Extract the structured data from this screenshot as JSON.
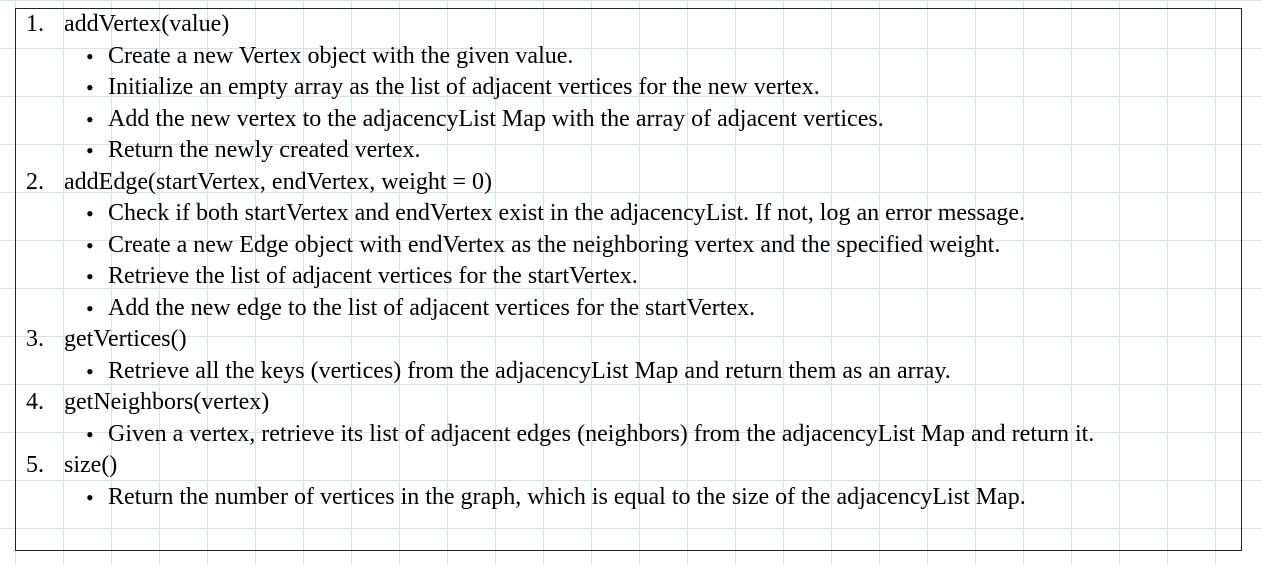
{
  "methods": [
    {
      "number": "1.",
      "signature": "addVertex(value)",
      "steps": [
        "Create a new Vertex object with the given value.",
        "Initialize an empty array as the list of adjacent vertices for the new vertex.",
        "Add the new vertex to the adjacencyList Map with the array of adjacent vertices.",
        "Return the newly created vertex."
      ]
    },
    {
      "number": "2.",
      "signature": "addEdge(startVertex, endVertex, weight = 0)",
      "steps": [
        "Check if both startVertex and endVertex exist in the adjacencyList. If not, log an error message.",
        "Create a new Edge object with endVertex as the neighboring vertex and the specified weight.",
        "Retrieve the list of adjacent vertices for the startVertex.",
        "Add the new edge to the list of adjacent vertices for the startVertex."
      ]
    },
    {
      "number": "3.",
      "signature": "getVertices()",
      "steps": [
        "Retrieve all the keys (vertices) from the adjacencyList Map and return them as an array."
      ]
    },
    {
      "number": "4.",
      "signature": "getNeighbors(vertex)",
      "steps": [
        "Given a vertex, retrieve its list of adjacent edges (neighbors) from the adjacencyList Map and return it."
      ]
    },
    {
      "number": "5.",
      "signature": "size()",
      "steps": [
        "Return the number of vertices in the graph, which is equal to the size of the adjacencyList Map."
      ]
    }
  ],
  "bullet_glyph": "•"
}
